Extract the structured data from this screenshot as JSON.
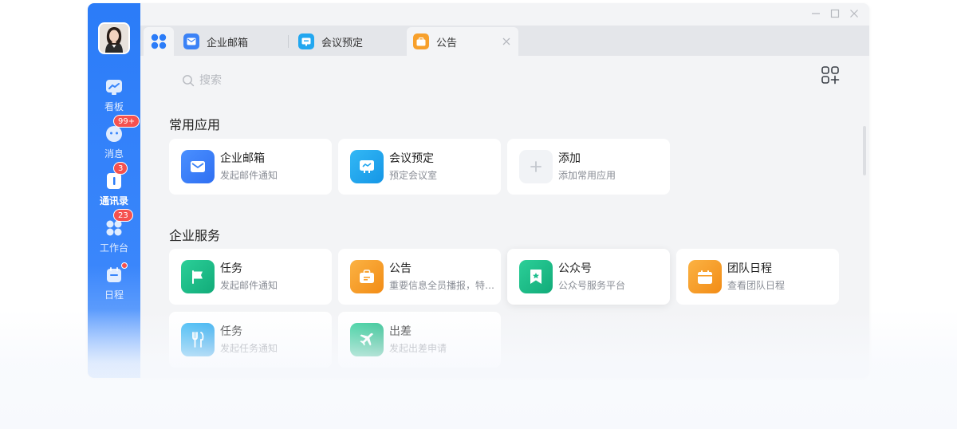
{
  "colors": {
    "sidebar": "#2b7cf8",
    "badge": "#f5514f",
    "mail_blue": "#3b82f6",
    "meeting_cyan": "#22a7f0",
    "notice_orange": "#f7a02c",
    "green": "#1fbf8f"
  },
  "sidebar": {
    "items": [
      {
        "label": "看板",
        "icon": "chart-icon"
      },
      {
        "label": "消息",
        "icon": "chat-icon",
        "badge": "99+"
      },
      {
        "label": "通讯录",
        "icon": "contacts-icon",
        "badge": "3",
        "active": true
      },
      {
        "label": "工作台",
        "icon": "apps-icon",
        "badge": "23"
      },
      {
        "label": "日程",
        "icon": "calendar-icon",
        "dot": true
      }
    ]
  },
  "tabs": [
    {
      "label": "企业邮箱",
      "icon": "mail-icon"
    },
    {
      "label": "会议预定",
      "icon": "meeting-icon"
    },
    {
      "label": "公告",
      "icon": "notice-icon",
      "active": true
    }
  ],
  "search": {
    "placeholder": "搜索"
  },
  "sections": {
    "common": {
      "title": "常用应用",
      "apps": [
        {
          "title": "企业邮箱",
          "subtitle": "发起邮件通知",
          "icon": "mail-icon"
        },
        {
          "title": "会议预定",
          "subtitle": "预定会议室",
          "icon": "meeting-icon"
        },
        {
          "title": "添加",
          "subtitle": "添加常用应用",
          "icon": "plus-icon"
        }
      ]
    },
    "services": {
      "title": "企业服务",
      "apps": [
        {
          "title": "任务",
          "subtitle": "发起邮件通知",
          "icon": "flag-icon"
        },
        {
          "title": "公告",
          "subtitle": "重要信息全员播报，特别提醒",
          "icon": "notice-icon"
        },
        {
          "title": "公众号",
          "subtitle": "公众号服务平台",
          "icon": "bookmark-icon"
        },
        {
          "title": "团队日程",
          "subtitle": "查看团队日程",
          "icon": "calendar-icon"
        },
        {
          "title": "任务",
          "subtitle": "发起任务通知",
          "icon": "dining-icon"
        },
        {
          "title": "出差",
          "subtitle": "发起出差申请",
          "icon": "plane-icon"
        }
      ]
    }
  }
}
